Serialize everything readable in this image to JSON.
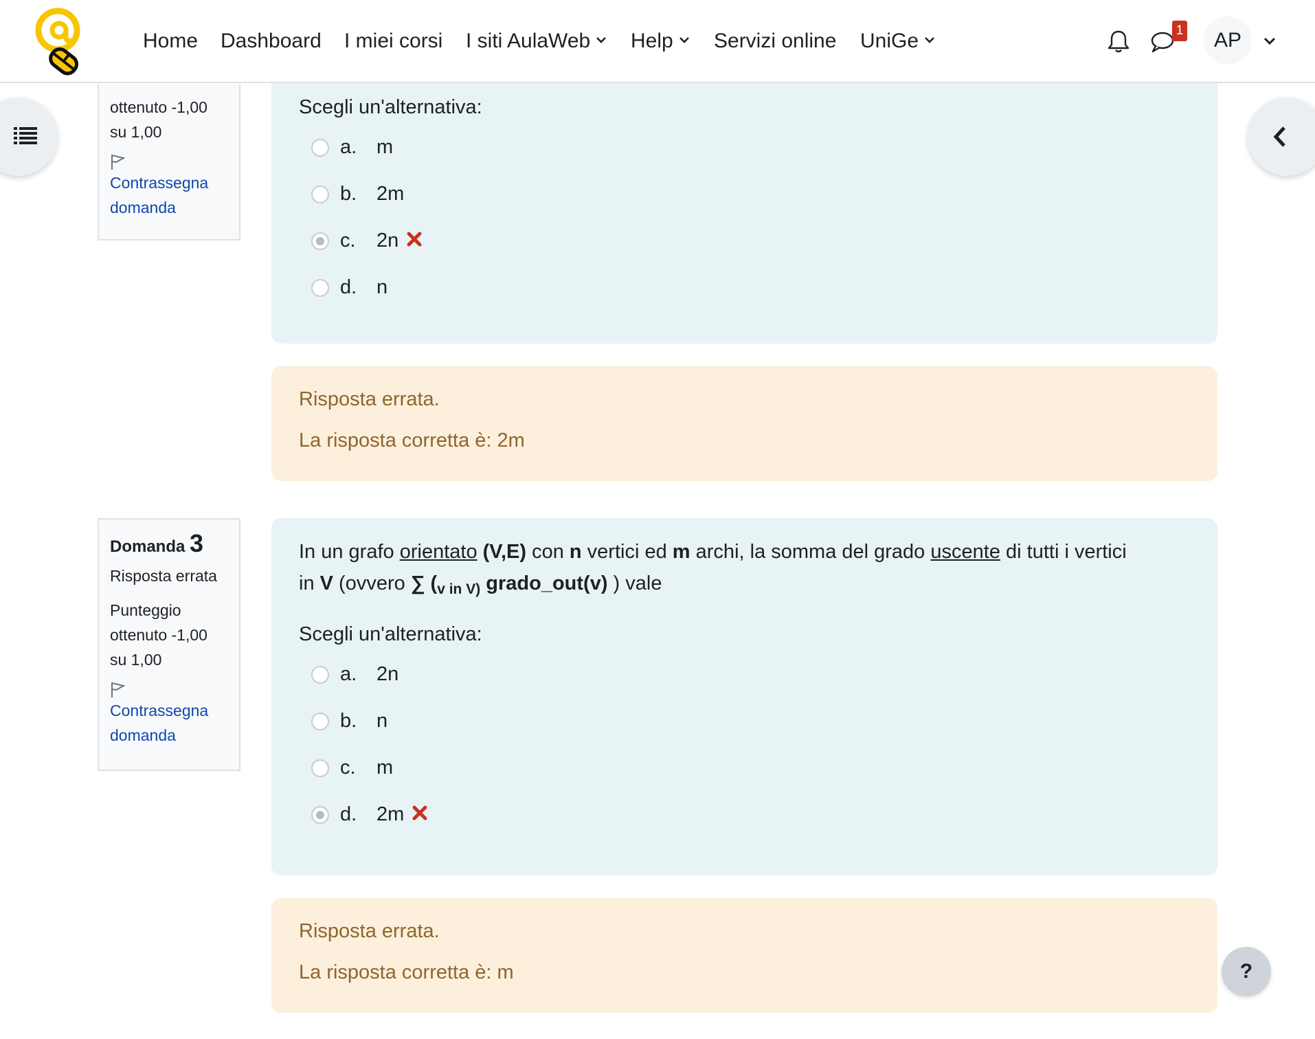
{
  "nav": {
    "items": [
      "Home",
      "Dashboard",
      "I miei corsi",
      "I siti AulaWeb",
      "Help",
      "Servizi online",
      "UniGe"
    ],
    "notification_count": "1",
    "avatar_initials": "AP"
  },
  "q2": {
    "grade_line1": "ottenuto -1,00",
    "grade_line2": "su 1,00",
    "flag_line1": "Contrassegna",
    "flag_line2": "domanda",
    "prompt": "Scegli un'alternativa:",
    "options": [
      {
        "letter": "a.",
        "text": "m",
        "selected": false
      },
      {
        "letter": "b.",
        "text": "2m",
        "selected": false
      },
      {
        "letter": "c.",
        "text": "2n",
        "selected": true
      },
      {
        "letter": "d.",
        "text": "n",
        "selected": false
      }
    ],
    "feedback": "Risposta errata.",
    "right_answer": "La risposta corretta è: 2m"
  },
  "q3": {
    "label": "Domanda",
    "number": "3",
    "state": "Risposta errata",
    "grade_line0": "Punteggio",
    "grade_line1": "ottenuto -1,00",
    "grade_line2": "su 1,00",
    "flag_line1": "Contrassegna",
    "flag_line2": "domanda",
    "text": {
      "t1": "In un grafo ",
      "u1": "orientato",
      "b1": " (V,E)",
      "t2": " con ",
      "b2": "n",
      "t3": " vertici ed ",
      "b3": "m",
      "t4": " archi, la somma del grado ",
      "u2": "uscente",
      "t5": " di tutti i vertici",
      "t6": "in ",
      "b4": "V",
      "t7": " (ovvero  ",
      "b5": "∑ (",
      "sub": "v in V)",
      "b6": " grado_out(v)",
      "t8": " ) vale"
    },
    "prompt": "Scegli un'alternativa:",
    "options": [
      {
        "letter": "a.",
        "text": "2n",
        "selected": false
      },
      {
        "letter": "b.",
        "text": "n",
        "selected": false
      },
      {
        "letter": "c.",
        "text": "m",
        "selected": false
      },
      {
        "letter": "d.",
        "text": "2m",
        "selected": true
      }
    ],
    "feedback": "Risposta errata.",
    "right_answer": "La risposta corretta è: m"
  },
  "help_label": "?"
}
